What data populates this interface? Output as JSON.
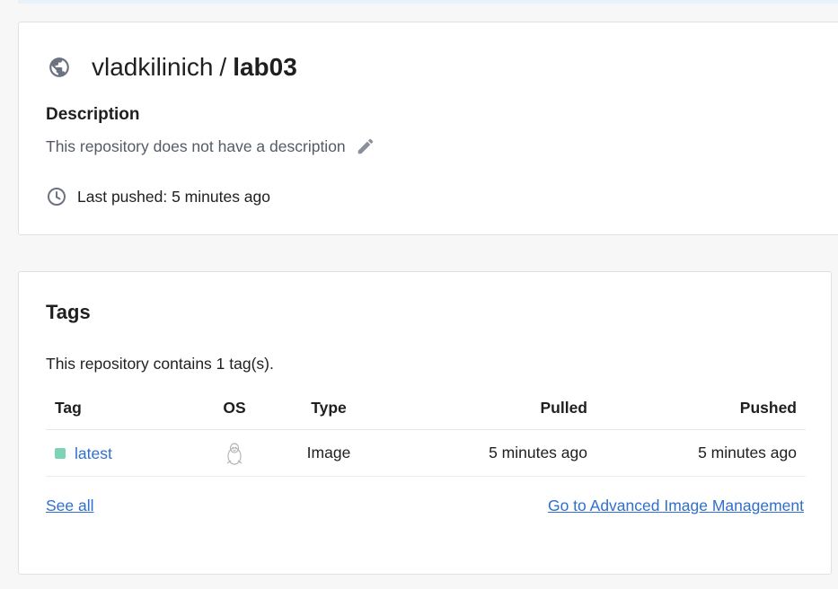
{
  "repo": {
    "owner": "vladkilinich",
    "separator": "/",
    "name": "lab03",
    "visibility_icon": "globe-icon",
    "description_heading": "Description",
    "description_text": "This repository does not have a description",
    "edit_icon": "pencil-icon",
    "last_pushed": "Last pushed: 5 minutes ago",
    "clock_icon": "clock-icon"
  },
  "tags": {
    "title": "Tags",
    "count_text": "This repository contains 1 tag(s).",
    "columns": {
      "tag": "Tag",
      "os": "OS",
      "type": "Type",
      "pulled": "Pulled",
      "pushed": "Pushed"
    },
    "rows": [
      {
        "tag": "latest",
        "os_icon": "linux-icon",
        "type": "Image",
        "pulled": "5 minutes ago",
        "pushed": "5 minutes ago",
        "status_color": "#7dd3b5"
      }
    ],
    "see_all": "See all",
    "advanced_link": "Go to Advanced Image Management"
  },
  "colors": {
    "link": "#2f6fd0",
    "card_border": "#e1e1e1",
    "page_bg": "#f7f7f7",
    "top_strip": "#e8f2fb"
  }
}
